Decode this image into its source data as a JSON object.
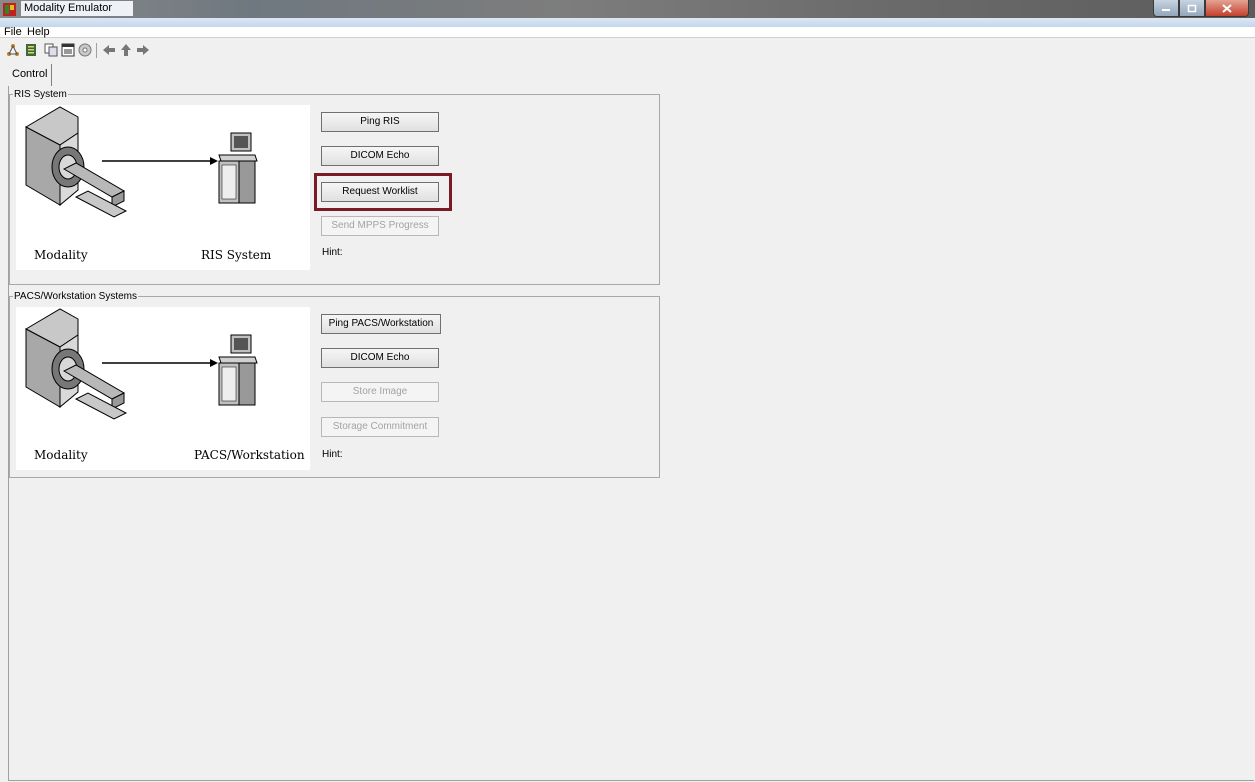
{
  "window": {
    "title": "Modality Emulator"
  },
  "menu": {
    "file": "File",
    "help": "Help"
  },
  "toolbar": {
    "icons": [
      "network-icon",
      "notebook-icon",
      "copy-icon",
      "window-icon",
      "disc-icon",
      "arrow-left-icon",
      "arrow-up-icon",
      "arrow-right-icon"
    ]
  },
  "tabs": {
    "control": "Control"
  },
  "ris": {
    "group_label": "RIS System",
    "left_label": "Modality",
    "right_label": "RIS System",
    "ping": "Ping RIS",
    "echo": "DICOM Echo",
    "worklist": "Request Worklist",
    "mpps": "Send MPPS Progress",
    "hint": "Hint:"
  },
  "pacs": {
    "group_label": "PACS/Workstation Systems",
    "left_label": "Modality",
    "right_label": "PACS/Workstation",
    "ping": "Ping PACS/Workstation",
    "echo": "DICOM Echo",
    "store": "Store Image",
    "commit": "Storage Commitment",
    "hint": "Hint:"
  },
  "colors": {
    "highlight": "#7a1a24",
    "disabled_text": "#a3a3a3"
  }
}
